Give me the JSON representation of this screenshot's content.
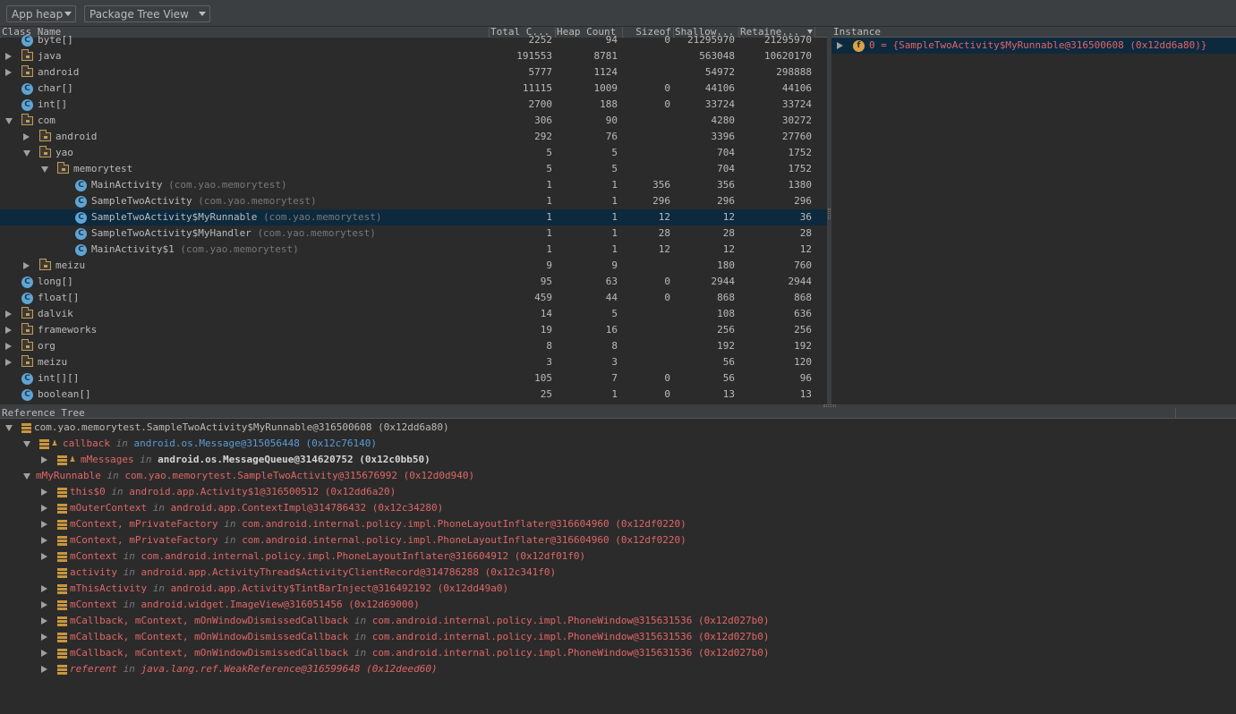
{
  "toolbar": {
    "heap_select": "App heap",
    "view_select": "Package Tree View"
  },
  "class_table": {
    "columns": [
      "Class Name",
      "Total C...",
      "Heap Count",
      "Sizeof",
      "Shallow...",
      "Retaine..."
    ],
    "rows": [
      {
        "depth": 0,
        "kind": "class",
        "expand": "none",
        "name": "byte[]",
        "pkg": "",
        "total": "2252",
        "heap": "94",
        "sizeof": "0",
        "shallow": "21295970",
        "retained": "21295970",
        "selected": false
      },
      {
        "depth": 0,
        "kind": "folder",
        "expand": "collapsed",
        "name": "java",
        "pkg": "",
        "total": "191553",
        "heap": "8781",
        "sizeof": "",
        "shallow": "563048",
        "retained": "10620170",
        "selected": false
      },
      {
        "depth": 0,
        "kind": "folder",
        "expand": "collapsed",
        "name": "android",
        "pkg": "",
        "total": "5777",
        "heap": "1124",
        "sizeof": "",
        "shallow": "54972",
        "retained": "298888",
        "selected": false
      },
      {
        "depth": 0,
        "kind": "class",
        "expand": "none",
        "name": "char[]",
        "pkg": "",
        "total": "11115",
        "heap": "1009",
        "sizeof": "0",
        "shallow": "44106",
        "retained": "44106",
        "selected": false
      },
      {
        "depth": 0,
        "kind": "class",
        "expand": "none",
        "name": "int[]",
        "pkg": "",
        "total": "2700",
        "heap": "188",
        "sizeof": "0",
        "shallow": "33724",
        "retained": "33724",
        "selected": false
      },
      {
        "depth": 0,
        "kind": "folder",
        "expand": "expanded",
        "name": "com",
        "pkg": "",
        "total": "306",
        "heap": "90",
        "sizeof": "",
        "shallow": "4280",
        "retained": "30272",
        "selected": false
      },
      {
        "depth": 1,
        "kind": "folder",
        "expand": "collapsed",
        "name": "android",
        "pkg": "",
        "total": "292",
        "heap": "76",
        "sizeof": "",
        "shallow": "3396",
        "retained": "27760",
        "selected": false
      },
      {
        "depth": 1,
        "kind": "folder",
        "expand": "expanded",
        "name": "yao",
        "pkg": "",
        "total": "5",
        "heap": "5",
        "sizeof": "",
        "shallow": "704",
        "retained": "1752",
        "selected": false
      },
      {
        "depth": 2,
        "kind": "folder",
        "expand": "expanded",
        "name": "memorytest",
        "pkg": "",
        "total": "5",
        "heap": "5",
        "sizeof": "",
        "shallow": "704",
        "retained": "1752",
        "selected": false
      },
      {
        "depth": 3,
        "kind": "class",
        "expand": "none",
        "name": "MainActivity",
        "pkg": "(com.yao.memorytest)",
        "total": "1",
        "heap": "1",
        "sizeof": "356",
        "shallow": "356",
        "retained": "1380",
        "selected": false
      },
      {
        "depth": 3,
        "kind": "class",
        "expand": "none",
        "name": "SampleTwoActivity",
        "pkg": "(com.yao.memorytest)",
        "total": "1",
        "heap": "1",
        "sizeof": "296",
        "shallow": "296",
        "retained": "296",
        "selected": false
      },
      {
        "depth": 3,
        "kind": "class",
        "expand": "none",
        "name": "SampleTwoActivity$MyRunnable",
        "pkg": "(com.yao.memorytest)",
        "total": "1",
        "heap": "1",
        "sizeof": "12",
        "shallow": "12",
        "retained": "36",
        "selected": true
      },
      {
        "depth": 3,
        "kind": "class",
        "expand": "none",
        "name": "SampleTwoActivity$MyHandler",
        "pkg": "(com.yao.memorytest)",
        "total": "1",
        "heap": "1",
        "sizeof": "28",
        "shallow": "28",
        "retained": "28",
        "selected": false
      },
      {
        "depth": 3,
        "kind": "class",
        "expand": "none",
        "name": "MainActivity$1",
        "pkg": "(com.yao.memorytest)",
        "total": "1",
        "heap": "1",
        "sizeof": "12",
        "shallow": "12",
        "retained": "12",
        "selected": false
      },
      {
        "depth": 1,
        "kind": "folder",
        "expand": "collapsed",
        "name": "meizu",
        "pkg": "",
        "total": "9",
        "heap": "9",
        "sizeof": "",
        "shallow": "180",
        "retained": "760",
        "selected": false
      },
      {
        "depth": 0,
        "kind": "class",
        "expand": "none",
        "name": "long[]",
        "pkg": "",
        "total": "95",
        "heap": "63",
        "sizeof": "0",
        "shallow": "2944",
        "retained": "2944",
        "selected": false
      },
      {
        "depth": 0,
        "kind": "class",
        "expand": "none",
        "name": "float[]",
        "pkg": "",
        "total": "459",
        "heap": "44",
        "sizeof": "0",
        "shallow": "868",
        "retained": "868",
        "selected": false
      },
      {
        "depth": 0,
        "kind": "folder",
        "expand": "collapsed",
        "name": "dalvik",
        "pkg": "",
        "total": "14",
        "heap": "5",
        "sizeof": "",
        "shallow": "108",
        "retained": "636",
        "selected": false
      },
      {
        "depth": 0,
        "kind": "folder",
        "expand": "collapsed",
        "name": "frameworks",
        "pkg": "",
        "total": "19",
        "heap": "16",
        "sizeof": "",
        "shallow": "256",
        "retained": "256",
        "selected": false
      },
      {
        "depth": 0,
        "kind": "folder",
        "expand": "collapsed",
        "name": "org",
        "pkg": "",
        "total": "8",
        "heap": "8",
        "sizeof": "",
        "shallow": "192",
        "retained": "192",
        "selected": false
      },
      {
        "depth": 0,
        "kind": "folder",
        "expand": "collapsed",
        "name": "meizu",
        "pkg": "",
        "total": "3",
        "heap": "3",
        "sizeof": "",
        "shallow": "56",
        "retained": "120",
        "selected": false
      },
      {
        "depth": 0,
        "kind": "class",
        "expand": "none",
        "name": "int[][]",
        "pkg": "",
        "total": "105",
        "heap": "7",
        "sizeof": "0",
        "shallow": "56",
        "retained": "96",
        "selected": false
      },
      {
        "depth": 0,
        "kind": "class",
        "expand": "none",
        "name": "boolean[]",
        "pkg": "",
        "total": "25",
        "heap": "1",
        "sizeof": "0",
        "shallow": "13",
        "retained": "13",
        "selected": false
      }
    ]
  },
  "instance_panel": {
    "title": "Instance",
    "row_text": "0 = {SampleTwoActivity$MyRunnable@316500608 (0x12dd6a80)}"
  },
  "reference_tree": {
    "title": "Reference Tree",
    "rows": [
      {
        "depth": 0,
        "expand": "expanded",
        "icon": "stack",
        "field": "com.yao.memorytest.SampleTwoActivity$MyRunnable@316500608 (0x12dd6a80)",
        "in": "",
        "obj": "",
        "style": "root"
      },
      {
        "depth": 1,
        "expand": "expanded",
        "icon": "stack-man",
        "field": "callback",
        "in": "in",
        "obj": "android.os.Message@315056448 (0x12c76140)",
        "style": "blue-obj"
      },
      {
        "depth": 2,
        "expand": "collapsed",
        "icon": "stack-man",
        "field": "mMessages",
        "in": "in",
        "obj": "android.os.MessageQueue@314620752 (0x12c0bb50)",
        "style": "white-obj"
      },
      {
        "depth": 1,
        "expand": "expanded",
        "icon": "none",
        "field": "mMyRunnable",
        "in": "in",
        "obj": "com.yao.memorytest.SampleTwoActivity@315676992 (0x12d0d940)",
        "style": "red"
      },
      {
        "depth": 2,
        "expand": "collapsed",
        "icon": "stack",
        "field": "this$0",
        "in": "in",
        "obj": "android.app.Activity$1@316500512 (0x12dd6a20)",
        "style": "red"
      },
      {
        "depth": 2,
        "expand": "collapsed",
        "icon": "stack",
        "field": "mOuterContext",
        "in": "in",
        "obj": "android.app.ContextImpl@314786432 (0x12c34280)",
        "style": "red"
      },
      {
        "depth": 2,
        "expand": "collapsed",
        "icon": "stack",
        "field": "mContext, mPrivateFactory",
        "in": "in",
        "obj": "com.android.internal.policy.impl.PhoneLayoutInflater@316604960 (0x12df0220)",
        "style": "red"
      },
      {
        "depth": 2,
        "expand": "collapsed",
        "icon": "stack",
        "field": "mContext, mPrivateFactory",
        "in": "in",
        "obj": "com.android.internal.policy.impl.PhoneLayoutInflater@316604960 (0x12df0220)",
        "style": "red"
      },
      {
        "depth": 2,
        "expand": "collapsed",
        "icon": "stack",
        "field": "mContext",
        "in": "in",
        "obj": "com.android.internal.policy.impl.PhoneLayoutInflater@316604912 (0x12df01f0)",
        "style": "red"
      },
      {
        "depth": 2,
        "expand": "none",
        "icon": "stack",
        "field": "activity",
        "in": "in",
        "obj": "android.app.ActivityThread$ActivityClientRecord@314786288 (0x12c341f0)",
        "style": "red"
      },
      {
        "depth": 2,
        "expand": "collapsed",
        "icon": "stack",
        "field": "mThisActivity",
        "in": "in",
        "obj": "android.app.Activity$TintBarInject@316492192 (0x12dd49a0)",
        "style": "red"
      },
      {
        "depth": 2,
        "expand": "collapsed",
        "icon": "stack",
        "field": "mContext",
        "in": "in",
        "obj": "android.widget.ImageView@316051456 (0x12d69000)",
        "style": "red"
      },
      {
        "depth": 2,
        "expand": "collapsed",
        "icon": "stack",
        "field": "mCallback, mContext, mOnWindowDismissedCallback",
        "in": "in",
        "obj": "com.android.internal.policy.impl.PhoneWindow@315631536 (0x12d027b0)",
        "style": "red"
      },
      {
        "depth": 2,
        "expand": "collapsed",
        "icon": "stack",
        "field": "mCallback, mContext, mOnWindowDismissedCallback",
        "in": "in",
        "obj": "com.android.internal.policy.impl.PhoneWindow@315631536 (0x12d027b0)",
        "style": "red"
      },
      {
        "depth": 2,
        "expand": "collapsed",
        "icon": "stack",
        "field": "mCallback, mContext, mOnWindowDismissedCallback",
        "in": "in",
        "obj": "com.android.internal.policy.impl.PhoneWindow@315631536 (0x12d027b0)",
        "style": "red"
      },
      {
        "depth": 2,
        "expand": "collapsed",
        "icon": "stack",
        "field": "referent",
        "in": "in",
        "obj": "java.lang.ref.WeakReference@316599648 (0x12deed60)",
        "style": "red-italic"
      }
    ]
  }
}
